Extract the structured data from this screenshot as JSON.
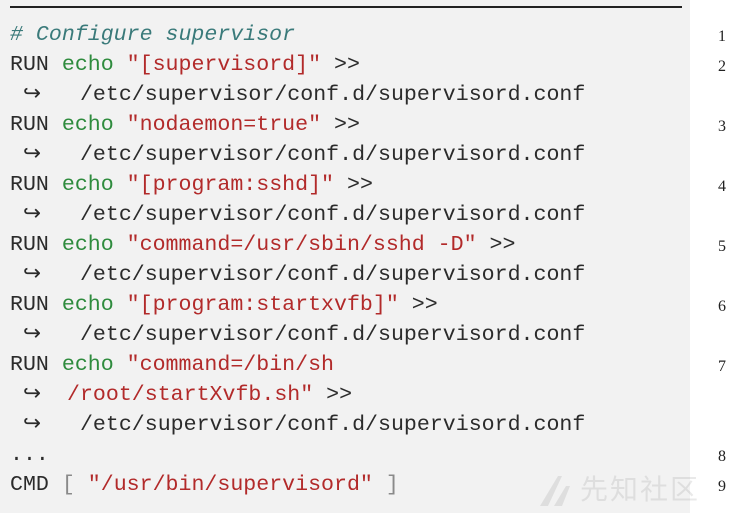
{
  "code": {
    "comment": "# Configure supervisor",
    "run_kw": "RUN",
    "echo_kw": "echo",
    "cmd_kw": "CMD",
    "redirect": ">>",
    "arrow": "↪",
    "conf_path": "/etc/supervisor/conf.d/supervisord.conf",
    "s1": "\"[supervisord]\"",
    "s2": "\"nodaemon=true\"",
    "s3": "\"[program:sshd]\"",
    "s4": "\"command=/usr/sbin/sshd -D\"",
    "s5": "\"[program:startxvfb]\"",
    "s6a": "\"command=/bin/sh",
    "s6b": "/root/startXvfb.sh\"",
    "ellipsis": "...",
    "cmd_open": "[",
    "cmd_str": "\"/usr/bin/supervisord\"",
    "cmd_close": "]"
  },
  "line_numbers": [
    "1",
    "2",
    "3",
    "4",
    "5",
    "6",
    "7",
    "8",
    "9"
  ],
  "watermark": {
    "text": "先知社区"
  },
  "colors": {
    "keyword": "#2b2b2b",
    "echo": "#2e8b3d",
    "string": "#b22a2a",
    "comment": "#3a7a7a",
    "background": "#f2f2f2"
  }
}
